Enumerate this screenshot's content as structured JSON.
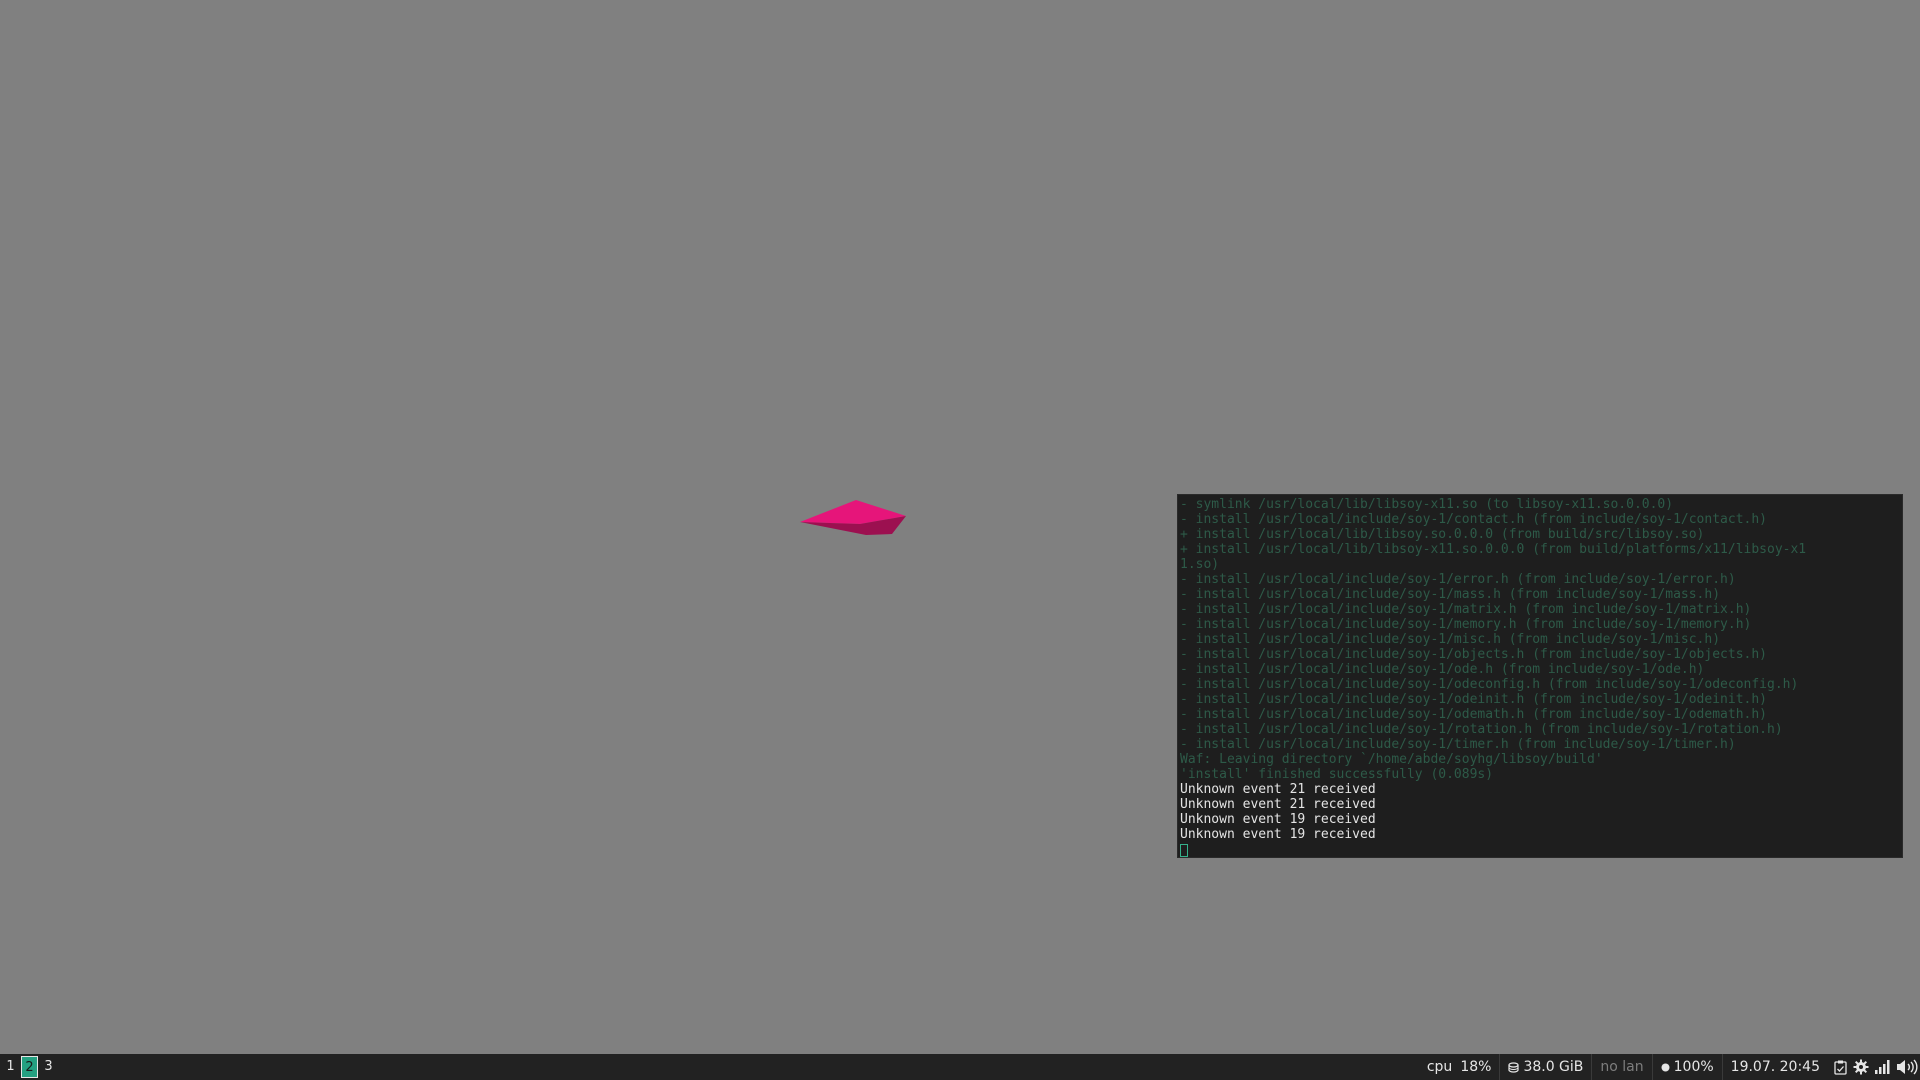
{
  "terminal": {
    "lines": [
      {
        "text": "- symlink /usr/local/lib/libsoy-x11.so (to libsoy-x11.so.0.0.0)",
        "style": "dim"
      },
      {
        "text": "- install /usr/local/include/soy-1/contact.h (from include/soy-1/contact.h)",
        "style": "dim"
      },
      {
        "text": "+ install /usr/local/lib/libsoy.so.0.0.0 (from build/src/libsoy.so)",
        "style": "dim"
      },
      {
        "text": "+ install /usr/local/lib/libsoy-x11.so.0.0.0 (from build/platforms/x11/libsoy-x1",
        "style": "dim"
      },
      {
        "text": "1.so)",
        "style": "dim"
      },
      {
        "text": "- install /usr/local/include/soy-1/error.h (from include/soy-1/error.h)",
        "style": "dim"
      },
      {
        "text": "- install /usr/local/include/soy-1/mass.h (from include/soy-1/mass.h)",
        "style": "dim"
      },
      {
        "text": "- install /usr/local/include/soy-1/matrix.h (from include/soy-1/matrix.h)",
        "style": "dim"
      },
      {
        "text": "- install /usr/local/include/soy-1/memory.h (from include/soy-1/memory.h)",
        "style": "dim"
      },
      {
        "text": "- install /usr/local/include/soy-1/misc.h (from include/soy-1/misc.h)",
        "style": "dim"
      },
      {
        "text": "- install /usr/local/include/soy-1/objects.h (from include/soy-1/objects.h)",
        "style": "dim"
      },
      {
        "text": "- install /usr/local/include/soy-1/ode.h (from include/soy-1/ode.h)",
        "style": "dim"
      },
      {
        "text": "- install /usr/local/include/soy-1/odeconfig.h (from include/soy-1/odeconfig.h)",
        "style": "dim"
      },
      {
        "text": "- install /usr/local/include/soy-1/odeinit.h (from include/soy-1/odeinit.h)",
        "style": "dim"
      },
      {
        "text": "- install /usr/local/include/soy-1/odemath.h (from include/soy-1/odemath.h)",
        "style": "dim"
      },
      {
        "text": "- install /usr/local/include/soy-1/rotation.h (from include/soy-1/rotation.h)",
        "style": "dim"
      },
      {
        "text": "- install /usr/local/include/soy-1/timer.h (from include/soy-1/timer.h)",
        "style": "dim"
      },
      {
        "text": "Waf: Leaving directory `/home/abde/soyhg/libsoy/build'",
        "style": "dim"
      },
      {
        "text": "'install' finished successfully (0.089s)",
        "style": "dim"
      },
      {
        "text": "Unknown event 21 received",
        "style": "bright"
      },
      {
        "text": "Unknown event 21 received",
        "style": "bright"
      },
      {
        "text": "Unknown event 19 received",
        "style": "bright"
      },
      {
        "text": "Unknown event 19 received",
        "style": "bright"
      }
    ]
  },
  "shape": {
    "top_color": "#e6157a",
    "bottom_color": "#9c1050"
  },
  "taskbar": {
    "workspaces": [
      {
        "label": "1",
        "active": false
      },
      {
        "label": "2",
        "active": true
      },
      {
        "label": "3",
        "active": false
      }
    ],
    "cpu_label": "cpu",
    "cpu_value": "18%",
    "disk_value": "38.0 GiB",
    "lan_value": "no lan",
    "battery_value": "100%",
    "datetime": "19.07. 20:45"
  },
  "colors": {
    "desktop_bg": "#808080",
    "terminal_bg": "#1e1e1e",
    "terminal_dim_text": "#2d5a48",
    "terminal_bright_text": "#e4e4e4",
    "taskbar_bg": "#222222",
    "workspace_active": "#24a081"
  },
  "icons": {
    "disk": "disk-icon",
    "battery": "battery-dot-icon",
    "clipboard": "clipboard-icon",
    "settings": "gear-icon",
    "signal": "signal-bars-icon",
    "volume": "volume-icon"
  }
}
